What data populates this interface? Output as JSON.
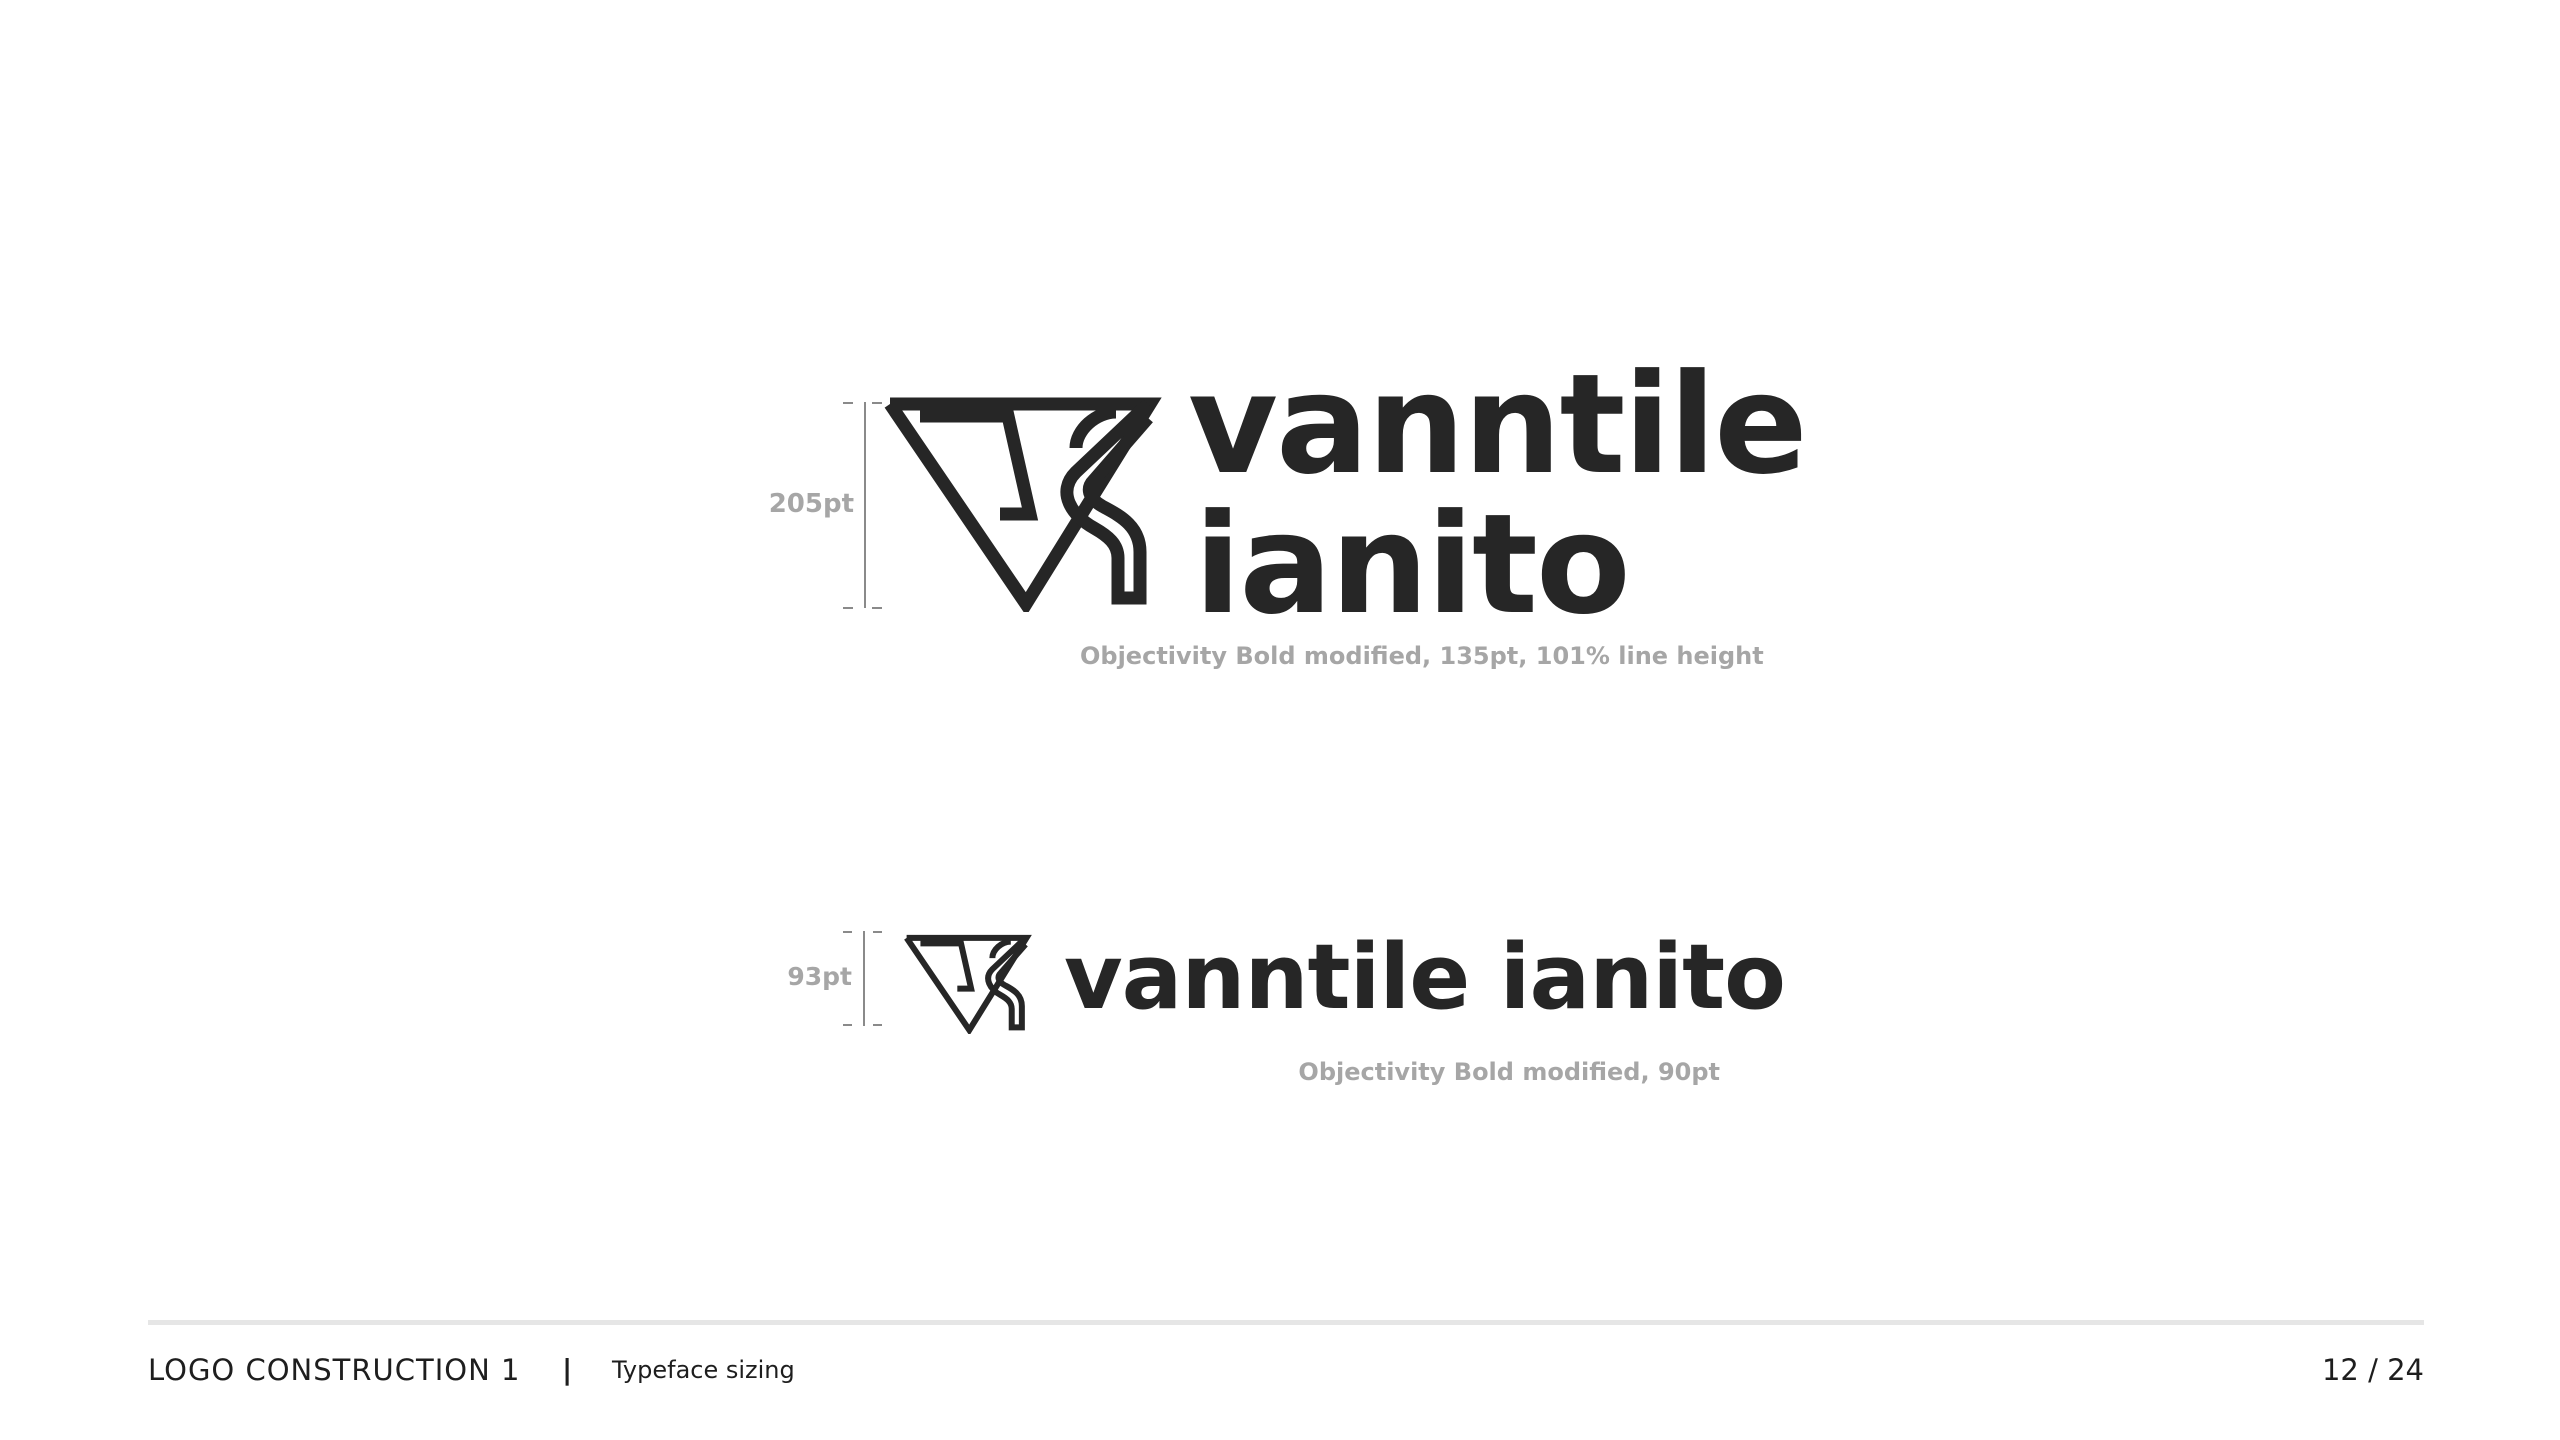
{
  "logo": {
    "large": {
      "dimension_label": "205pt",
      "line1": "vanntile",
      "line2": "ianito",
      "caption": "Objectivity Bold modified, 135pt,  101% line height"
    },
    "small": {
      "dimension_label": "93pt",
      "wordmark": "vanntile ianito",
      "caption": "Objectivity Bold modified, 90pt"
    }
  },
  "footer": {
    "section": "LOGO CONSTRUCTION 1",
    "separator": "|",
    "subtitle": "Typeface sizing",
    "page_number": "12 / 24"
  },
  "colors": {
    "ink": "#262626",
    "caption_gray": "#a6a6a6",
    "rule_gray": "#e6e6e6"
  }
}
